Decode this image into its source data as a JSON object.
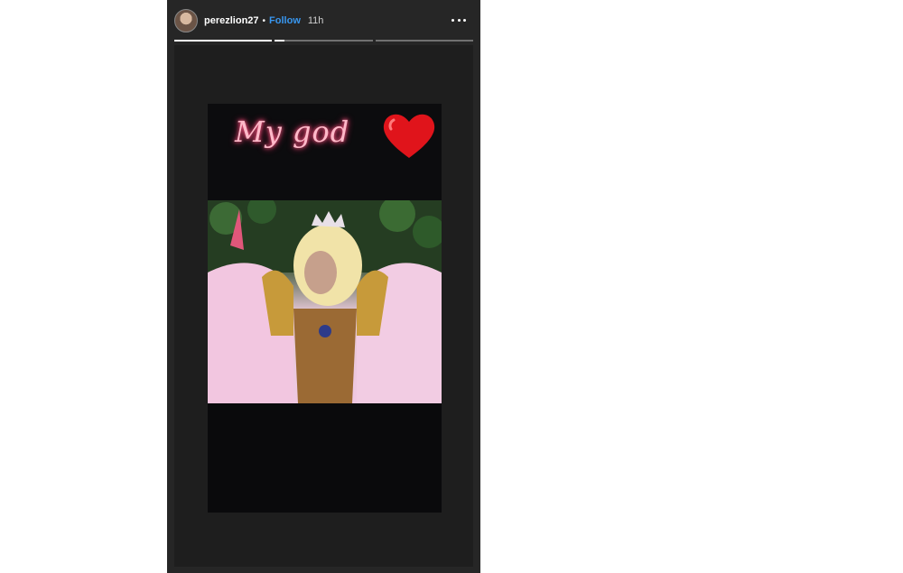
{
  "header": {
    "username": "perezlion27",
    "separator": "•",
    "follow_label": "Follow",
    "time_ago": "11h"
  },
  "progress": {
    "segments": [
      1,
      0.1,
      0
    ]
  },
  "story": {
    "caption": "My god"
  },
  "colors": {
    "follow": "#3897f0",
    "caption_neon": "#ffb9c9",
    "heart": "#e0141b"
  }
}
